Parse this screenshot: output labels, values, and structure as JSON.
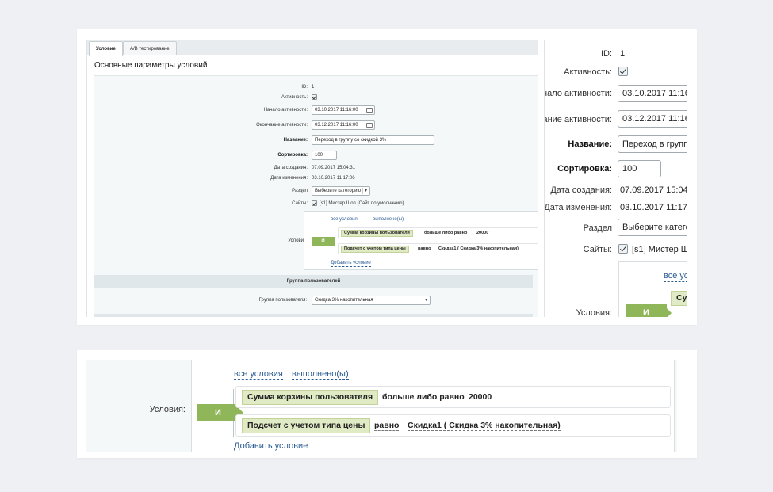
{
  "tabs": [
    {
      "label": "Условие",
      "active": true
    },
    {
      "label": "A/B тестирование",
      "active": false
    }
  ],
  "page_title": "Основные параметры условий",
  "form": {
    "id_label": "ID:",
    "id_value": "1",
    "active_label": "Активность:",
    "active_checked": true,
    "start_label": "Начало активности:",
    "start_value": "03.10.2017 11:16:00",
    "end_label": "Окончание активности:",
    "end_value": "03.12.2017 11:16:00",
    "name_label": "Название:",
    "name_value": "Переход в группу со скидкой 3%",
    "sort_label": "Сортировка:",
    "sort_value": "100",
    "created_label": "Дата создания:",
    "created_value": "07.09.2017 15:04:31",
    "modified_label": "Дата изменения:",
    "modified_value": "03.10.2017 11:17:06",
    "section_label": "Раздел",
    "section_value": "Выберите категорию",
    "sites_label": "Сайты:",
    "sites_value": "[s1] Мистер Шоп (Сайт по умолчанию)",
    "conditions_label": "Условия:"
  },
  "conditions": {
    "logic": "И",
    "all_conditions": "все условия",
    "fulfilled": "выполнено(ы)",
    "rows": [
      {
        "field": "Сумма корзины пользователя",
        "operator": "больше либо равно",
        "value": "20000"
      },
      {
        "field": "Подсчет с учетом типа цены",
        "operator": "равно",
        "value": "Скидка1 ( Скидка 3% накопительная)"
      }
    ],
    "add_condition": "Добавить условие"
  },
  "user_group": {
    "section_title": "Группа пользователей",
    "label": "Группа пользователя:",
    "value": "Скидка 3% накопительная"
  },
  "zoom": {
    "start_label_cut": "ачало активности:",
    "start_value_cut": "03.10.2017 11:16",
    "end_label_cut": "чание активности:",
    "end_value_cut": "03.12.2017 11:16",
    "name_value_cut": "Переход в группу",
    "created_value_cut": "07.09.2017 15:04:3",
    "modified_value_cut": "03.10.2017 11:17:0",
    "section_value_cut": "Выберите катего",
    "sites_value_cut": "[s1] Мистер Шо",
    "all_conditions_cut": "все ус",
    "chip_cut": "Су"
  },
  "colors": {
    "logic_green": "#8fb658",
    "chip_green": "#e0ebc6",
    "link_blue": "#2a5b93",
    "page_bg": "#eef0f4"
  }
}
